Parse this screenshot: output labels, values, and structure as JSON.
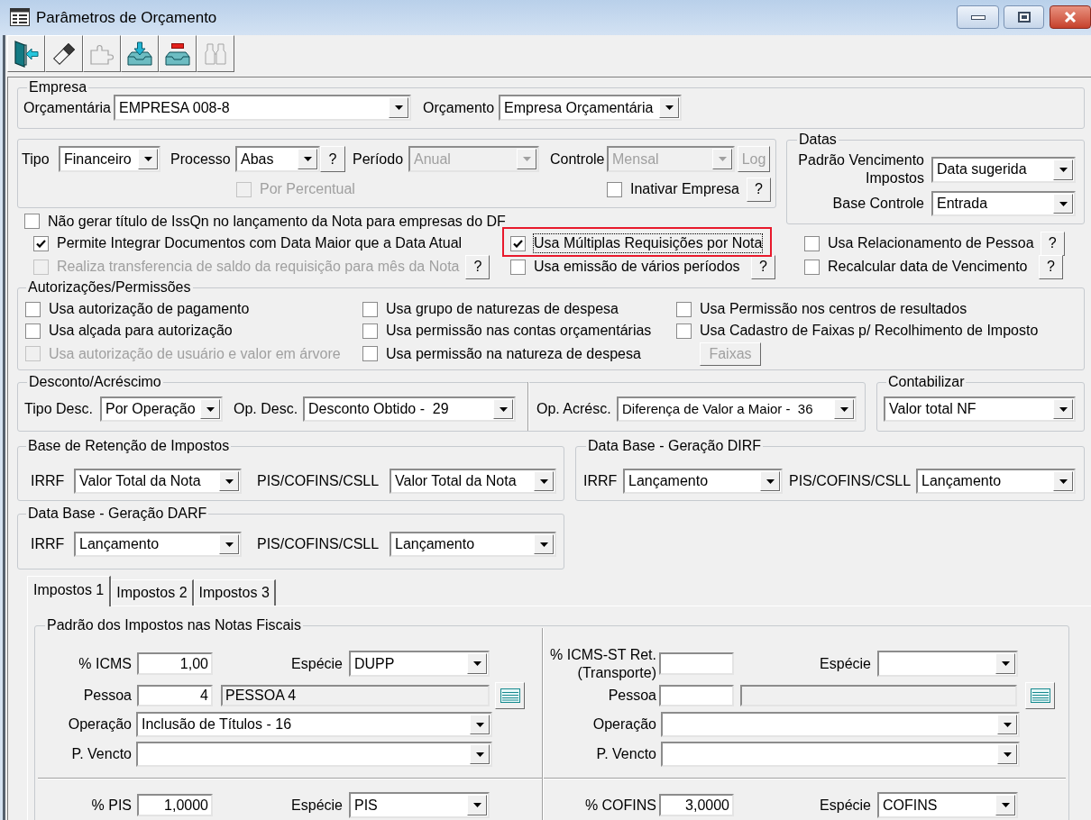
{
  "window": {
    "title": "Parâmetros de Orçamento"
  },
  "toolbar": [
    {
      "disabled": false
    },
    {
      "disabled": false
    },
    {
      "disabled": true
    },
    {
      "disabled": false
    },
    {
      "disabled": false
    },
    {
      "disabled": true
    }
  ],
  "empresa": {
    "title": "Empresa",
    "orcamentaria": {
      "label": "Orçamentária",
      "value": "EMPRESA 008-8"
    },
    "orcamento": {
      "label": "Orçamento",
      "value": "Empresa Orçamentária"
    }
  },
  "geral": {
    "tipo": {
      "label": "Tipo",
      "value": "Financeiro",
      "disabled": false
    },
    "processo": {
      "label": "Processo",
      "value": "Abas",
      "disabled": false,
      "help": "?"
    },
    "periodo": {
      "label": "Período",
      "value": "Anual",
      "disabled": true
    },
    "controle": {
      "label": "Controle",
      "value": "Mensal",
      "disabled": true
    },
    "log_button": {
      "label": "Log",
      "disabled": true
    },
    "por_percentual": {
      "label": "Por Percentual",
      "checked": false,
      "disabled": true
    },
    "inativar_empresa": {
      "label": "Inativar Empresa",
      "checked": false,
      "disabled": false,
      "help": "?"
    }
  },
  "datas": {
    "title": "Datas",
    "fields": [
      {
        "label": "Padrão Vencimento Impostos",
        "value": "Data sugerida"
      },
      {
        "label": "Base Controle",
        "value": "Entrada"
      }
    ]
  },
  "options": [
    [
      {
        "label": "Não gerar título de IssQn no lançamento da Nota para empresas do DF",
        "checked": false,
        "disabled": false,
        "focused": false,
        "highlighted": false
      }
    ],
    [
      {
        "label": "Permite Integrar Documentos com Data Maior que a Data Atual",
        "checked": true,
        "disabled": false,
        "focused": false,
        "highlighted": false
      },
      {
        "label": "Usa Múltiplas Requisições por Nota",
        "checked": true,
        "disabled": false,
        "focused": true,
        "highlighted": true
      },
      {
        "label": "Usa Relacionamento de Pessoa",
        "checked": false,
        "disabled": false,
        "focused": false,
        "highlighted": false,
        "help": "?"
      }
    ],
    [
      {
        "label": "Realiza transferencia de saldo da requisição para mês da Nota",
        "checked": false,
        "disabled": true,
        "focused": false,
        "highlighted": false,
        "help": "?"
      },
      {
        "label": "Usa emissão de vários períodos",
        "checked": false,
        "disabled": false,
        "focused": false,
        "highlighted": false,
        "help": "?"
      },
      {
        "label": "Recalcular data de Vencimento",
        "checked": false,
        "disabled": false,
        "focused": false,
        "highlighted": false,
        "help": "?"
      }
    ]
  ],
  "autorizacoes": {
    "title": "Autorizações/Permissões",
    "columns": [
      [
        {
          "kind": "checkbox",
          "label": "Usa autorização de pagamento",
          "checked": false,
          "disabled": false
        },
        {
          "kind": "checkbox",
          "label": "Usa alçada para autorização",
          "checked": false,
          "disabled": false
        },
        {
          "kind": "checkbox",
          "label": "Usa autorização de usuário e valor em árvore",
          "checked": false,
          "disabled": true
        }
      ],
      [
        {
          "kind": "checkbox",
          "label": "Usa grupo de naturezas de despesa",
          "checked": false,
          "disabled": false
        },
        {
          "kind": "checkbox",
          "label": "Usa permissão nas contas orçamentárias",
          "checked": false,
          "disabled": false
        },
        {
          "kind": "checkbox",
          "label": "Usa permissão na natureza de despesa",
          "checked": false,
          "disabled": false
        }
      ],
      [
        {
          "kind": "checkbox",
          "label": "Usa Permissão nos centros de resultados",
          "checked": false,
          "disabled": false
        },
        {
          "kind": "checkbox",
          "label": "Usa Cadastro de Faixas p/ Recolhimento de Imposto",
          "checked": false,
          "disabled": false
        },
        {
          "kind": "button",
          "label": "Faixas",
          "disabled": true
        }
      ]
    ]
  },
  "desconto": {
    "title": "Desconto/Acréscimo",
    "fields": [
      {
        "label": "Tipo Desc.",
        "value": "Por Operação"
      },
      {
        "label": "Op. Desc.",
        "value": "Desconto Obtido -  29"
      },
      {
        "label": "Op. Acrésc.",
        "value": "Diferença de Valor a Maior -  36"
      }
    ]
  },
  "contabilizar": {
    "title": "Contabilizar",
    "value": "Valor total NF"
  },
  "base_retencao": {
    "title": "Base de Retenção de Impostos",
    "fields": [
      {
        "label": "IRRF",
        "value": "Valor Total da Nota"
      },
      {
        "label": "PIS/COFINS/CSLL",
        "value": "Valor Total da Nota"
      }
    ]
  },
  "dirf": {
    "title": "Data Base - Geração DIRF",
    "fields": [
      {
        "label": "IRRF",
        "value": "Lançamento"
      },
      {
        "label": "PIS/COFINS/CSLL",
        "value": "Lançamento"
      }
    ]
  },
  "darf": {
    "title": "Data Base - Geração DARF",
    "fields": [
      {
        "label": "IRRF",
        "value": "Lançamento"
      },
      {
        "label": "PIS/COFINS/CSLL",
        "value": "Lançamento"
      }
    ]
  },
  "tabs": [
    {
      "label": "Impostos 1",
      "selected": true
    },
    {
      "label": "Impostos 2",
      "selected": false
    },
    {
      "label": "Impostos 3",
      "selected": false
    }
  ],
  "impostos": {
    "title": "Padrão dos Impostos nas Notas Fiscais",
    "rows": [
      [
        {
          "rate": {
            "label": "% ICMS",
            "value": "1,00"
          },
          "especie": {
            "label": "Espécie",
            "value": "DUPP"
          },
          "pessoa": {
            "label": "Pessoa",
            "code": "4",
            "name": "PESSOA 4"
          },
          "operacao": {
            "label": "Operação",
            "value": "Inclusão de Títulos - 16"
          },
          "vencimento": {
            "label": "P. Vencto"
          }
        },
        {
          "rate": {
            "label": "% ICMS-ST Ret.(Transporte)"
          },
          "especie": {
            "label": "Espécie"
          },
          "pessoa": {
            "label": "Pessoa"
          },
          "operacao": {
            "label": "Operação"
          },
          "vencimento": {
            "label": "P. Vencto"
          }
        }
      ],
      [
        {
          "rate": {
            "label": "% PIS",
            "value": "1,0000"
          },
          "especie": {
            "label": "Espécie",
            "value": "PIS"
          }
        },
        {
          "rate": {
            "label": "% COFINS",
            "value": "3,0000"
          },
          "especie": {
            "label": "Espécie",
            "value": "COFINS"
          }
        }
      ]
    ]
  }
}
